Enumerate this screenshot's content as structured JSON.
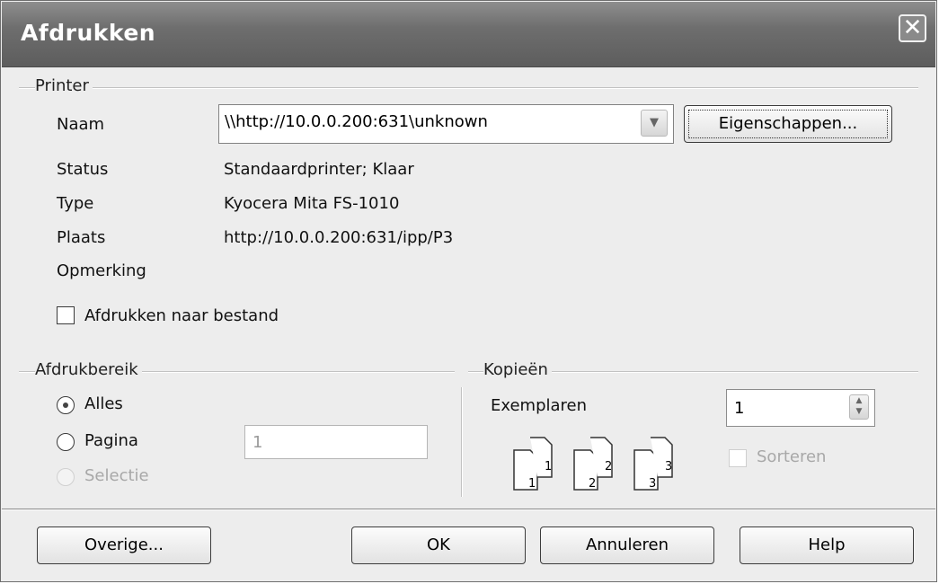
{
  "dialog": {
    "title": "Afdrukken",
    "close_label": "✕"
  },
  "printer": {
    "group_label": "Printer",
    "name_label": "Naam",
    "name_value": "\\\\http://10.0.0.200:631\\unknown",
    "properties_button": "Eigenschappen...",
    "status_label": "Status",
    "status_value": "Standaardprinter; Klaar",
    "type_label": "Type",
    "type_value": "Kyocera Mita FS-1010",
    "location_label": "Plaats",
    "location_value": "http://10.0.0.200:631/ipp/P3",
    "comment_label": "Opmerking",
    "print_to_file_label": "Afdrukken naar bestand",
    "print_to_file_checked": false
  },
  "print_range": {
    "group_label": "Afdrukbereik",
    "all_label": "Alles",
    "pages_label": "Pagina",
    "selection_label": "Selectie",
    "selected": "all",
    "pages_value": "1"
  },
  "copies": {
    "group_label": "Kopieën",
    "count_label": "Exemplaren",
    "count_value": "1",
    "collate_label": "Sorteren",
    "collate_enabled": false,
    "page_numbers": [
      "1",
      "1",
      "2",
      "2",
      "3",
      "3"
    ]
  },
  "buttons": {
    "more": "Overige...",
    "ok": "OK",
    "cancel": "Annuleren",
    "help": "Help"
  }
}
